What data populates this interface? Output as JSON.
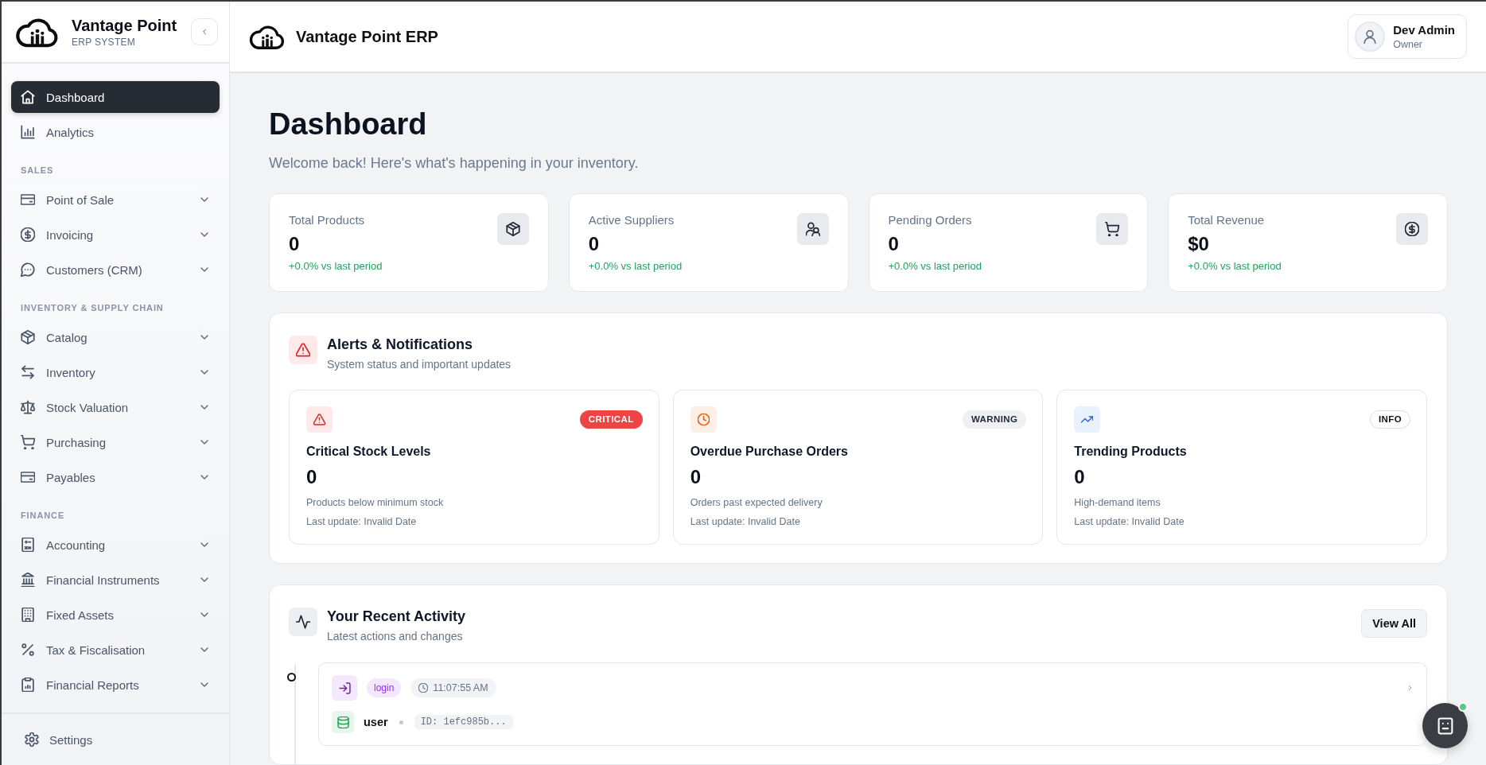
{
  "sidebar": {
    "brand": {
      "name": "Vantage Point",
      "tagline": "ERP SYSTEM"
    },
    "sections": [
      {
        "items": [
          {
            "kind": "link",
            "label": "Dashboard",
            "selected": true
          },
          {
            "kind": "link",
            "label": "Analytics",
            "selected": false
          }
        ]
      },
      {
        "heading": "SALES",
        "items": [
          {
            "kind": "group",
            "label": "Point of Sale",
            "selected": false,
            "expanded": false
          },
          {
            "kind": "group",
            "label": "Invoicing",
            "selected": false,
            "expanded": false
          },
          {
            "kind": "group",
            "label": "Customers (CRM)",
            "selected": false,
            "expanded": false
          }
        ]
      },
      {
        "heading": "INVENTORY & SUPPLY CHAIN",
        "items": [
          {
            "kind": "group",
            "label": "Catalog",
            "selected": false,
            "expanded": false
          },
          {
            "kind": "group",
            "label": "Inventory",
            "selected": false,
            "expanded": false
          },
          {
            "kind": "group",
            "label": "Stock Valuation",
            "selected": false,
            "expanded": false
          },
          {
            "kind": "group",
            "label": "Purchasing",
            "selected": false,
            "expanded": false
          },
          {
            "kind": "group",
            "label": "Payables",
            "selected": false,
            "expanded": false
          }
        ]
      },
      {
        "heading": "FINANCE",
        "items": [
          {
            "kind": "group",
            "label": "Accounting",
            "selected": false,
            "expanded": false
          },
          {
            "kind": "group",
            "label": "Financial Instruments",
            "selected": false,
            "expanded": false
          },
          {
            "kind": "group",
            "label": "Fixed Assets",
            "selected": false,
            "expanded": false
          },
          {
            "kind": "group",
            "label": "Tax & Fiscalisation",
            "selected": false,
            "expanded": false
          },
          {
            "kind": "group",
            "label": "Financial Reports",
            "selected": false,
            "expanded": false
          }
        ]
      }
    ],
    "footer": {
      "label": "Settings"
    }
  },
  "header": {
    "title": "Vantage Point ERP",
    "user": {
      "name": "Dev Admin",
      "role": "Owner"
    }
  },
  "page": {
    "title": "Dashboard",
    "subtitle": "Welcome back! Here's what's happening in your inventory."
  },
  "stats": [
    {
      "label": "Total Products",
      "value": "0",
      "change": "+0.0% vs last period"
    },
    {
      "label": "Active Suppliers",
      "value": "0",
      "change": "+0.0% vs last period"
    },
    {
      "label": "Pending Orders",
      "value": "0",
      "change": "+0.0% vs last period"
    },
    {
      "label": "Total Revenue",
      "value": "$0",
      "change": "+0.0% vs last period"
    }
  ],
  "alerts": {
    "title": "Alerts & Notifications",
    "subtitle": "System status and important updates",
    "items": [
      {
        "kind": "critical",
        "badge": "CRITICAL",
        "title": "Critical Stock Levels",
        "value": "0",
        "description": "Products below minimum stock",
        "updated": "Last update: Invalid Date"
      },
      {
        "kind": "warning",
        "badge": "WARNING",
        "title": "Overdue Purchase Orders",
        "value": "0",
        "description": "Orders past expected delivery",
        "updated": "Last update: Invalid Date"
      },
      {
        "kind": "info",
        "badge": "INFO",
        "title": "Trending Products",
        "value": "0",
        "description": "High-demand items",
        "updated": "Last update: Invalid Date"
      }
    ]
  },
  "activity": {
    "title": "Your Recent Activity",
    "subtitle": "Latest actions and changes",
    "button": "View All",
    "items": [
      {
        "kind": "login",
        "action": "login",
        "time": "11:07:55 AM",
        "entity": "user",
        "id": "ID: 1efc985b..."
      }
    ]
  },
  "assistant_button": {
    "online": true
  }
}
